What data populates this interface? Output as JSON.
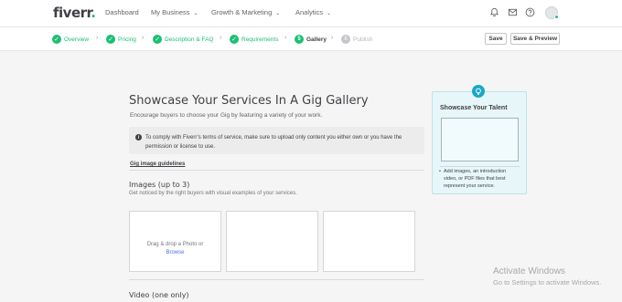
{
  "app": {
    "logo": "fiverr",
    "logo_dot": "."
  },
  "topnav": {
    "links": [
      {
        "label": "Dashboard",
        "dropdown": false
      },
      {
        "label": "My Business",
        "dropdown": true
      },
      {
        "label": "Growth & Marketing",
        "dropdown": true
      },
      {
        "label": "Analytics",
        "dropdown": true
      }
    ],
    "icons": [
      "bell-icon",
      "mail-icon",
      "help-icon"
    ]
  },
  "steps": [
    {
      "label": "Overview",
      "status": "done"
    },
    {
      "label": "Pricing",
      "status": "done"
    },
    {
      "label": "Description & FAQ",
      "status": "done"
    },
    {
      "label": "Requirements",
      "status": "done"
    },
    {
      "label": "Gallery",
      "status": "active"
    },
    {
      "label": "Publish",
      "status": "pending"
    }
  ],
  "actions": {
    "save": "Save",
    "save_preview": "Save & Preview"
  },
  "main": {
    "title": "Showcase Your Services In A Gig Gallery",
    "subtitle": "Encourage buyers to choose your Gig by featuring a variety of your work.",
    "notice": "To comply with Fiverr’s terms of service, make sure to upload only content you either own or you have the permission or license to use.",
    "guidelines_link": "Gig image guidelines",
    "images": {
      "title": "Images (up to 3)",
      "subtitle": "Get noticed by the right buyers with visual examples of your services.",
      "drop_text": "Drag & drop a Photo or",
      "browse": "Browse"
    },
    "video": {
      "title": "Video (one only)"
    }
  },
  "tip": {
    "title": "Showcase Your Talent",
    "bullet": "Add images, an introduction video, or PDF files that best represent your service."
  },
  "watermark": {
    "line1": "Activate Windows",
    "line2": "Go to Settings to activate Windows."
  },
  "colors": {
    "brand": "#1dbf73",
    "tip_accent": "#1aa8c6",
    "link": "#4a73e8"
  }
}
